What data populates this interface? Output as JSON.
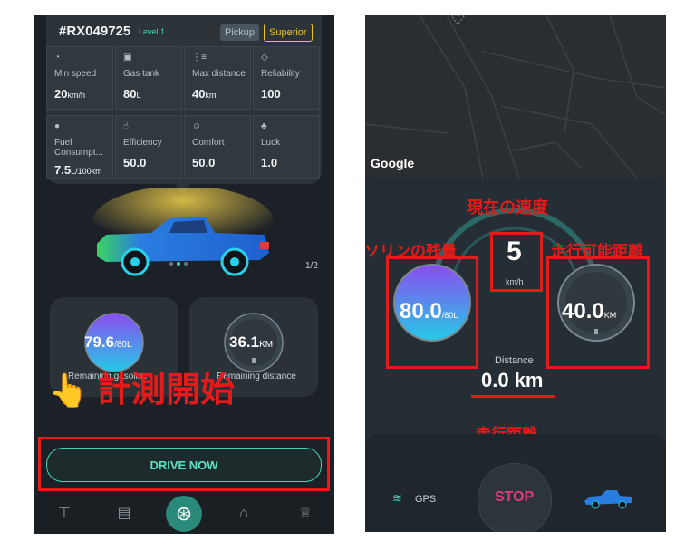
{
  "left": {
    "vehicle_id": "#RX049725",
    "level": "Level 1",
    "tags": [
      "Pickup",
      "Superior"
    ],
    "stats": [
      {
        "icon": "speedometer-icon",
        "label": "Min speed",
        "value": "20",
        "unit": "km/h"
      },
      {
        "icon": "gas-tank-icon",
        "label": "Gas tank",
        "value": "80",
        "unit": "L"
      },
      {
        "icon": "route-icon",
        "label": "Max distance",
        "value": "40",
        "unit": "km"
      },
      {
        "icon": "shield-icon",
        "label": "Reliability",
        "value": "100",
        "unit": ""
      },
      {
        "icon": "droplet-icon",
        "label": "Fuel Consumpt...",
        "value": "7.5",
        "unit": "L/100km"
      },
      {
        "icon": "thumbs-up-icon",
        "label": "Efficiency",
        "value": "50.0",
        "unit": ""
      },
      {
        "icon": "smile-icon",
        "label": "Comfort",
        "value": "50.0",
        "unit": ""
      },
      {
        "icon": "clover-icon",
        "label": "Luck",
        "value": "1.0",
        "unit": ""
      }
    ],
    "page_indicator": "1/2",
    "gas_gauge": {
      "value": "79.6",
      "unit": "/80L",
      "label": "Remaining gasoline",
      "fill_fraction": 0.995
    },
    "distance_gauge": {
      "value": "36.1",
      "unit": "KM",
      "label": "Remaining distance"
    },
    "annotation": "計測開始",
    "drive_button": "DRIVE NOW",
    "nav": [
      "sign-icon",
      "garage-icon",
      "steering-wheel-icon",
      "shop-icon",
      "trophy-icon"
    ],
    "colors": {
      "accent": "#3fd6b3",
      "annotation_red": "#e51a1a",
      "superior": "#e8c62a"
    }
  },
  "right": {
    "map_attribution": "Google",
    "speed": {
      "value": "5",
      "unit": "km/h"
    },
    "gas": {
      "value": "80.0",
      "unit": "/80L"
    },
    "range": {
      "value": "40.0",
      "unit": "KM"
    },
    "distance": {
      "label": "Distance",
      "value": "0.0 km"
    },
    "gps_label": "GPS",
    "stop_label": "STOP",
    "annotations": {
      "current_speed": "現在の速度",
      "gas_remaining": "ガソリンの残量",
      "range_remaining": "走行可能距離",
      "distance_traveled": "走行距離"
    }
  }
}
